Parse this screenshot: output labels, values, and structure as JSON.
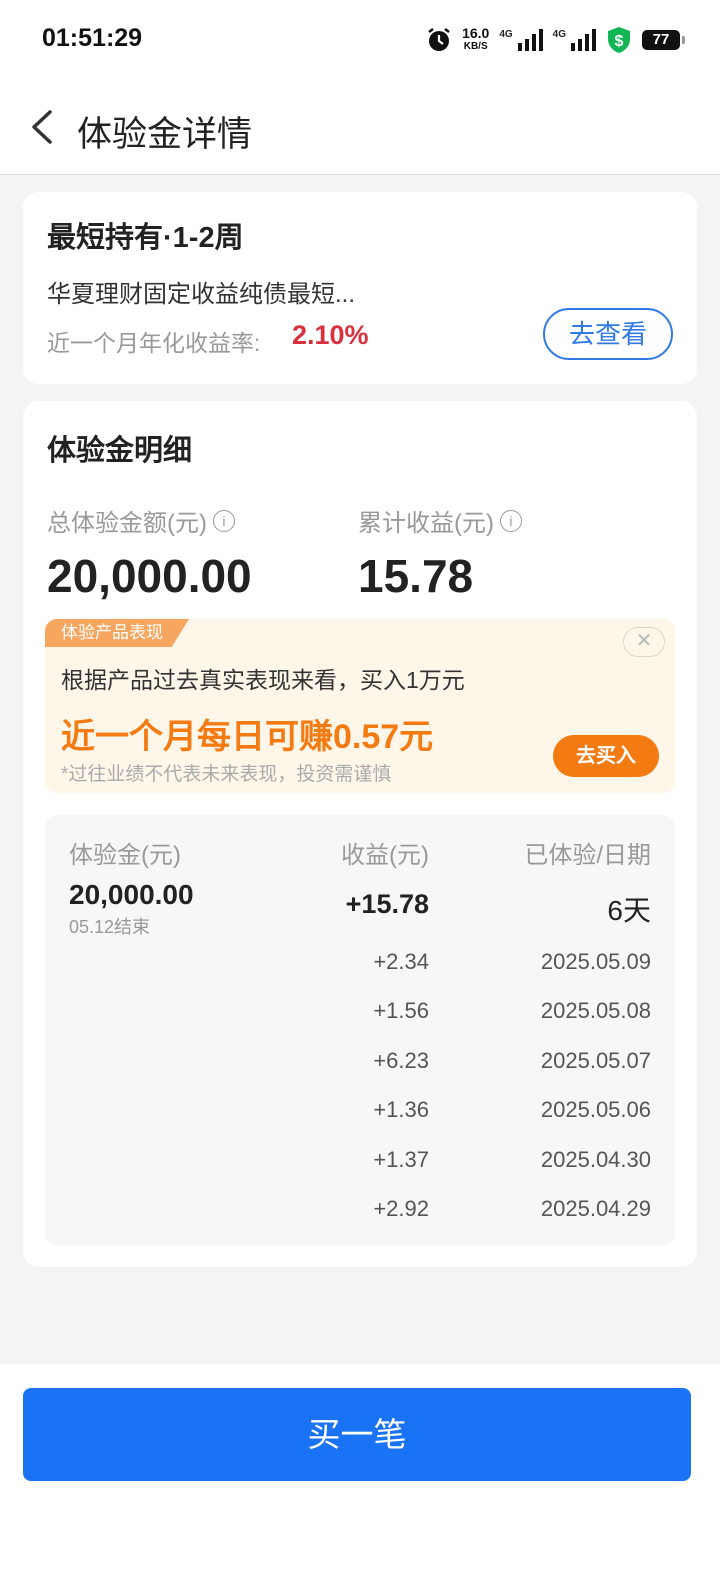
{
  "status": {
    "time": "01:51:29",
    "speed_value": "16.0",
    "speed_unit": "KB/S",
    "net1": "4G",
    "net2": "4G",
    "battery": "77",
    "icons": [
      "alarm-icon",
      "signal-icon",
      "security-shield-icon",
      "battery-icon"
    ]
  },
  "header": {
    "title": "体验金详情"
  },
  "product": {
    "title": "最短持有·1-2周",
    "name": "华夏理财固定收益纯债最短...",
    "rate_label": "近一个月年化收益率:",
    "rate": "2.10%",
    "view_button": "去查看"
  },
  "summary": {
    "title": "体验金明细",
    "total_label": "总体验金额(元)",
    "total_value": "20,000.00",
    "earnings_label": "累计收益(元)",
    "earnings_value": "15.78"
  },
  "promo": {
    "tag": "体验产品表现",
    "desc": "根据产品过去真实表现来看，买入1万元",
    "highlight": "近一个月每日可赚0.57元",
    "note": "*过往业绩不代表未来表现，投资需谨慎",
    "buy_button": "去买入"
  },
  "table": {
    "headers": [
      "体验金(元)",
      "收益(元)",
      "已体验/日期"
    ],
    "amount": "20,000.00",
    "end_date": "05.12结束",
    "total_income": "+15.78",
    "days": "6天",
    "rows": [
      {
        "income": "+2.34",
        "date": "2025.05.09"
      },
      {
        "income": "+1.56",
        "date": "2025.05.08"
      },
      {
        "income": "+6.23",
        "date": "2025.05.07"
      },
      {
        "income": "+1.36",
        "date": "2025.05.06"
      },
      {
        "income": "+1.37",
        "date": "2025.04.30"
      },
      {
        "income": "+2.92",
        "date": "2025.04.29"
      }
    ]
  },
  "footer": {
    "buy_label": "买一笔"
  },
  "colors": {
    "accent": "#1a73f5",
    "orange": "#f47a12",
    "rate_red": "#d8303f"
  }
}
